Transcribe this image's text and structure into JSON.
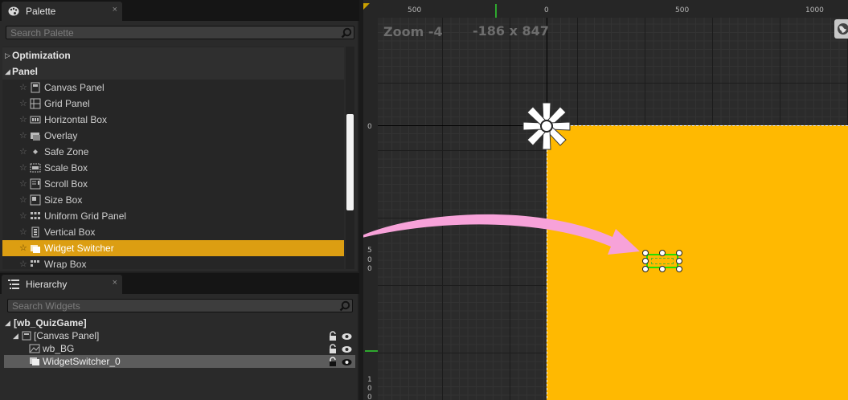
{
  "palette": {
    "tab_label": "Palette",
    "close_glyph": "×",
    "search_placeholder": "Search Palette",
    "categories": [
      {
        "label": "Optimization",
        "expanded": false
      },
      {
        "label": "Panel",
        "expanded": true
      }
    ],
    "items": [
      {
        "label": "Canvas Panel",
        "icon": "canvas-panel-icon"
      },
      {
        "label": "Grid Panel",
        "icon": "grid-panel-icon"
      },
      {
        "label": "Horizontal Box",
        "icon": "horizontal-box-icon"
      },
      {
        "label": "Overlay",
        "icon": "overlay-icon"
      },
      {
        "label": "Safe Zone",
        "icon": "safe-zone-icon"
      },
      {
        "label": "Scale Box",
        "icon": "scale-box-icon"
      },
      {
        "label": "Scroll Box",
        "icon": "scroll-box-icon"
      },
      {
        "label": "Size Box",
        "icon": "size-box-icon"
      },
      {
        "label": "Uniform Grid Panel",
        "icon": "uniform-grid-panel-icon"
      },
      {
        "label": "Vertical Box",
        "icon": "vertical-box-icon"
      },
      {
        "label": "Widget Switcher",
        "icon": "widget-switcher-icon",
        "selected": true
      },
      {
        "label": "Wrap Box",
        "icon": "wrap-box-icon"
      }
    ]
  },
  "hierarchy": {
    "tab_label": "Hierarchy",
    "close_glyph": "×",
    "search_placeholder": "Search Widgets",
    "root": "[wb_QuizGame]",
    "nodes": [
      {
        "label": "[Canvas Panel]"
      },
      {
        "label": "wb_BG"
      },
      {
        "label": "WidgetSwitcher_0",
        "selected": true
      }
    ]
  },
  "viewport": {
    "zoom_text": "Zoom -4",
    "size_text": "-186 x 847",
    "ruler_top": [
      "500",
      "0",
      "500",
      "1000"
    ],
    "ruler_left": [
      "0",
      "5",
      "0",
      "0",
      "1",
      "0",
      "0"
    ],
    "colors": {
      "canvas_fill": "#ffb901",
      "selection": "#21e000",
      "arrow": "#f7a2d9",
      "highlight": "#dc9e12"
    }
  }
}
